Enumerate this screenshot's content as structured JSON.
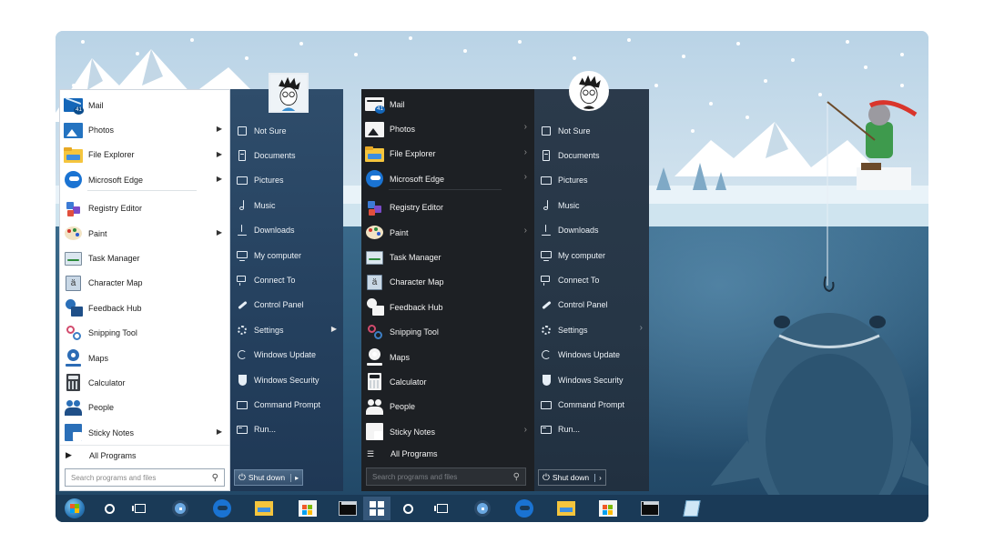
{
  "menu_classic": {
    "programs": [
      {
        "label": "Mail",
        "icon": "mail-icon",
        "badge": "41",
        "arrow": false
      },
      {
        "label": "Photos",
        "icon": "photos-icon",
        "arrow": true
      },
      {
        "label": "File Explorer",
        "icon": "file-explorer-icon",
        "arrow": true
      },
      {
        "label": "Microsoft Edge",
        "icon": "edge-icon",
        "arrow": true
      },
      {
        "label": "Registry Editor",
        "icon": "registry-editor-icon",
        "arrow": false
      },
      {
        "label": "Paint",
        "icon": "paint-icon",
        "arrow": true
      },
      {
        "label": "Task Manager",
        "icon": "task-manager-icon",
        "arrow": false
      },
      {
        "label": "Character Map",
        "icon": "character-map-icon",
        "arrow": false
      },
      {
        "label": "Feedback Hub",
        "icon": "feedback-hub-icon",
        "arrow": false
      },
      {
        "label": "Snipping Tool",
        "icon": "snipping-tool-icon",
        "arrow": false
      },
      {
        "label": "Maps",
        "icon": "maps-icon",
        "arrow": false
      },
      {
        "label": "Calculator",
        "icon": "calculator-icon",
        "arrow": false
      },
      {
        "label": "People",
        "icon": "people-icon",
        "arrow": false
      },
      {
        "label": "Sticky Notes",
        "icon": "sticky-notes-icon",
        "arrow": true
      }
    ],
    "all_programs": "All Programs",
    "search_placeholder": "Search programs and files",
    "places": [
      {
        "label": "Not Sure",
        "icon": "user-folder-icon"
      },
      {
        "label": "Documents",
        "icon": "documents-icon"
      },
      {
        "label": "Pictures",
        "icon": "pictures-icon"
      },
      {
        "label": "Music",
        "icon": "music-icon"
      },
      {
        "label": "Downloads",
        "icon": "downloads-icon"
      },
      {
        "label": "My computer",
        "icon": "computer-icon"
      },
      {
        "label": "Connect To",
        "icon": "connect-icon"
      },
      {
        "label": "Control Panel",
        "icon": "control-panel-icon"
      },
      {
        "label": "Settings",
        "icon": "settings-icon",
        "arrow": true
      },
      {
        "label": "Windows Update",
        "icon": "update-icon"
      },
      {
        "label": "Windows Security",
        "icon": "shield-icon"
      },
      {
        "label": "Command Prompt",
        "icon": "cmd-icon"
      },
      {
        "label": "Run...",
        "icon": "run-icon"
      }
    ],
    "shutdown": "Shut down"
  },
  "menu_dark": {
    "programs": [
      {
        "label": "Mail",
        "icon": "mail-icon",
        "badge": "41",
        "arrow": false
      },
      {
        "label": "Photos",
        "icon": "photos-icon",
        "arrow": true
      },
      {
        "label": "File Explorer",
        "icon": "file-explorer-icon",
        "arrow": true
      },
      {
        "label": "Microsoft Edge",
        "icon": "edge-icon",
        "arrow": true
      },
      {
        "label": "Registry Editor",
        "icon": "registry-editor-icon",
        "arrow": false
      },
      {
        "label": "Paint",
        "icon": "paint-icon",
        "arrow": true
      },
      {
        "label": "Task Manager",
        "icon": "task-manager-icon",
        "arrow": false
      },
      {
        "label": "Character Map",
        "icon": "character-map-icon",
        "arrow": false
      },
      {
        "label": "Feedback Hub",
        "icon": "feedback-hub-icon",
        "arrow": false
      },
      {
        "label": "Snipping Tool",
        "icon": "snipping-tool-icon",
        "arrow": false
      },
      {
        "label": "Maps",
        "icon": "maps-icon",
        "arrow": false
      },
      {
        "label": "Calculator",
        "icon": "calculator-icon",
        "arrow": false
      },
      {
        "label": "People",
        "icon": "people-icon",
        "arrow": false
      },
      {
        "label": "Sticky Notes",
        "icon": "sticky-notes-icon",
        "arrow": true
      }
    ],
    "all_programs": "All Programs",
    "search_placeholder": "Search programs and files",
    "places": [
      {
        "label": "Not Sure",
        "icon": "user-folder-icon"
      },
      {
        "label": "Documents",
        "icon": "documents-icon"
      },
      {
        "label": "Pictures",
        "icon": "pictures-icon"
      },
      {
        "label": "Music",
        "icon": "music-icon"
      },
      {
        "label": "Downloads",
        "icon": "downloads-icon"
      },
      {
        "label": "My computer",
        "icon": "computer-icon"
      },
      {
        "label": "Connect To",
        "icon": "connect-icon"
      },
      {
        "label": "Control Panel",
        "icon": "control-panel-icon"
      },
      {
        "label": "Settings",
        "icon": "settings-icon",
        "arrow": true
      },
      {
        "label": "Windows Update",
        "icon": "update-icon"
      },
      {
        "label": "Windows Security",
        "icon": "shield-icon"
      },
      {
        "label": "Command Prompt",
        "icon": "cmd-icon"
      },
      {
        "label": "Run...",
        "icon": "run-icon"
      }
    ],
    "shutdown": "Shut down"
  },
  "taskbar": [
    {
      "name": "start-orb-button",
      "icon": "windows7-orb-icon"
    },
    {
      "name": "cortana-button",
      "icon": "circle-icon"
    },
    {
      "name": "task-view-button",
      "icon": "task-view-icon"
    },
    {
      "name": "registry-pin-button",
      "icon": "registry-editor-icon"
    },
    {
      "name": "edge-pin-button",
      "icon": "edge-icon"
    },
    {
      "name": "explorer-pin-button",
      "icon": "file-explorer-icon"
    },
    {
      "name": "store-pin-button",
      "icon": "store-icon"
    },
    {
      "name": "cmd-pin-button",
      "icon": "cmd-icon"
    },
    {
      "name": "start-button",
      "icon": "windows10-logo-icon",
      "active": true
    },
    {
      "name": "cortana-button-2",
      "icon": "circle-icon"
    },
    {
      "name": "task-view-button-2",
      "icon": "task-view-icon"
    },
    {
      "name": "registry-pin-button-2",
      "icon": "registry-editor-icon"
    },
    {
      "name": "edge-pin-button-2",
      "icon": "edge-icon"
    },
    {
      "name": "explorer-pin-button-2",
      "icon": "file-explorer-icon"
    },
    {
      "name": "store-pin-button-2",
      "icon": "store-icon"
    },
    {
      "name": "cmd-pin-button-2",
      "icon": "cmd-icon"
    },
    {
      "name": "notes-pin-button",
      "icon": "notepad-icon"
    }
  ],
  "colors": {
    "sky": "#c5dbe9",
    "water": "#2e5878",
    "taskbar": "#1a3a57",
    "classic_places": "#2f4d6b",
    "dark_programs": "#1d2024"
  }
}
